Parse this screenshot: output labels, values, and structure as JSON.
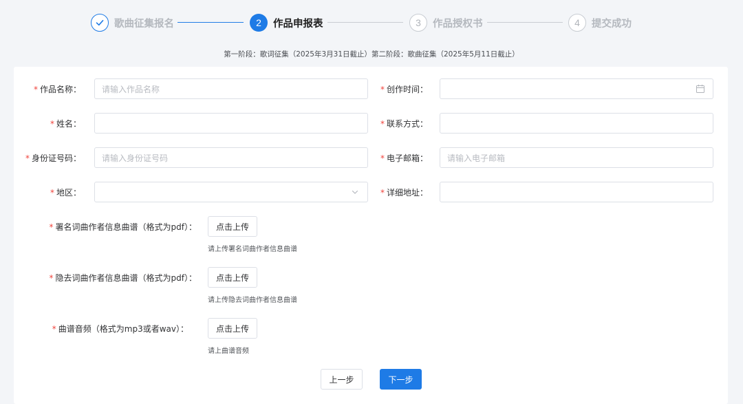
{
  "steps": [
    {
      "label": "歌曲征集报名",
      "number": "1",
      "status": "done"
    },
    {
      "label": "作品申报表",
      "number": "2",
      "status": "active"
    },
    {
      "label": "作品授权书",
      "number": "3",
      "status": "wait"
    },
    {
      "label": "提交成功",
      "number": "4",
      "status": "wait"
    }
  ],
  "stage_note": "第一阶段：歌词征集（2025年3月31日截止）第二阶段：歌曲征集（2025年5月11日截止）",
  "form": {
    "work_name": {
      "label": "作品名称：",
      "placeholder": "请输入作品名称",
      "value": ""
    },
    "create_time": {
      "label": "创作时间：",
      "placeholder": "",
      "value": ""
    },
    "name": {
      "label": "姓名：",
      "placeholder": "",
      "value": ""
    },
    "contact": {
      "label": "联系方式：",
      "placeholder": "",
      "value": ""
    },
    "id_number": {
      "label": "身份证号码：",
      "placeholder": "请输入身份证号码",
      "value": ""
    },
    "email": {
      "label": "电子邮箱：",
      "placeholder": "请输入电子邮箱",
      "value": ""
    },
    "region": {
      "label": "地区：",
      "placeholder": "",
      "value": ""
    },
    "address": {
      "label": "详细地址：",
      "placeholder": "",
      "value": ""
    },
    "upload_signed": {
      "label": "署名词曲作者信息曲谱（格式为pdf）：",
      "button": "点击上传",
      "tip": "请上传署名词曲作者信息曲谱"
    },
    "upload_hidden": {
      "label": "隐去词曲作者信息曲谱（格式为pdf）：",
      "button": "点击上传",
      "tip": "请上传隐去词曲作者信息曲谱"
    },
    "upload_audio": {
      "label": "曲谱音频（格式为mp3或者wav）：",
      "button": "点击上传",
      "tip": "请上曲谱音频"
    }
  },
  "required_mark": "*",
  "buttons": {
    "prev": "上一步",
    "next": "下一步"
  },
  "icons": {
    "step1": "check-icon",
    "date": "calendar-icon",
    "region": "chevron-down-icon"
  },
  "colors": {
    "primary": "#1e7be6",
    "required": "#f0443c",
    "background": "#f3f5f8"
  }
}
